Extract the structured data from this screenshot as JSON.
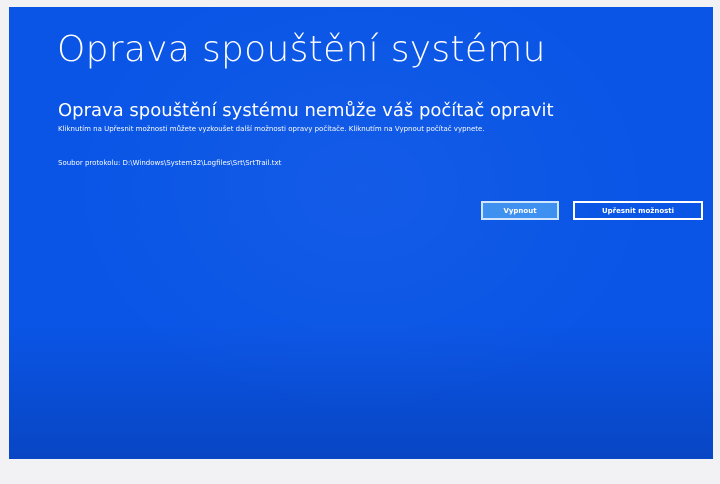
{
  "screen": {
    "title": "Oprava spouštění systému",
    "heading": "Oprava spouštění systému nemůže váš počítač opravit",
    "description": "Kliknutím na Upřesnit možnosti můžete vyzkoušet další možnosti opravy počítače. Kliknutím na Vypnout počítač vypnete.",
    "log_file": "Soubor protokolu: D:\\Windows\\System32\\Logfiles\\Srt\\SrtTrail.txt"
  },
  "buttons": {
    "shutdown_label": "Vypnout",
    "advanced_label": "Upřesnit možnosti"
  },
  "colors": {
    "background": "#0a55e6",
    "text": "#ffffff",
    "focused_button": "#3b8ff0"
  }
}
